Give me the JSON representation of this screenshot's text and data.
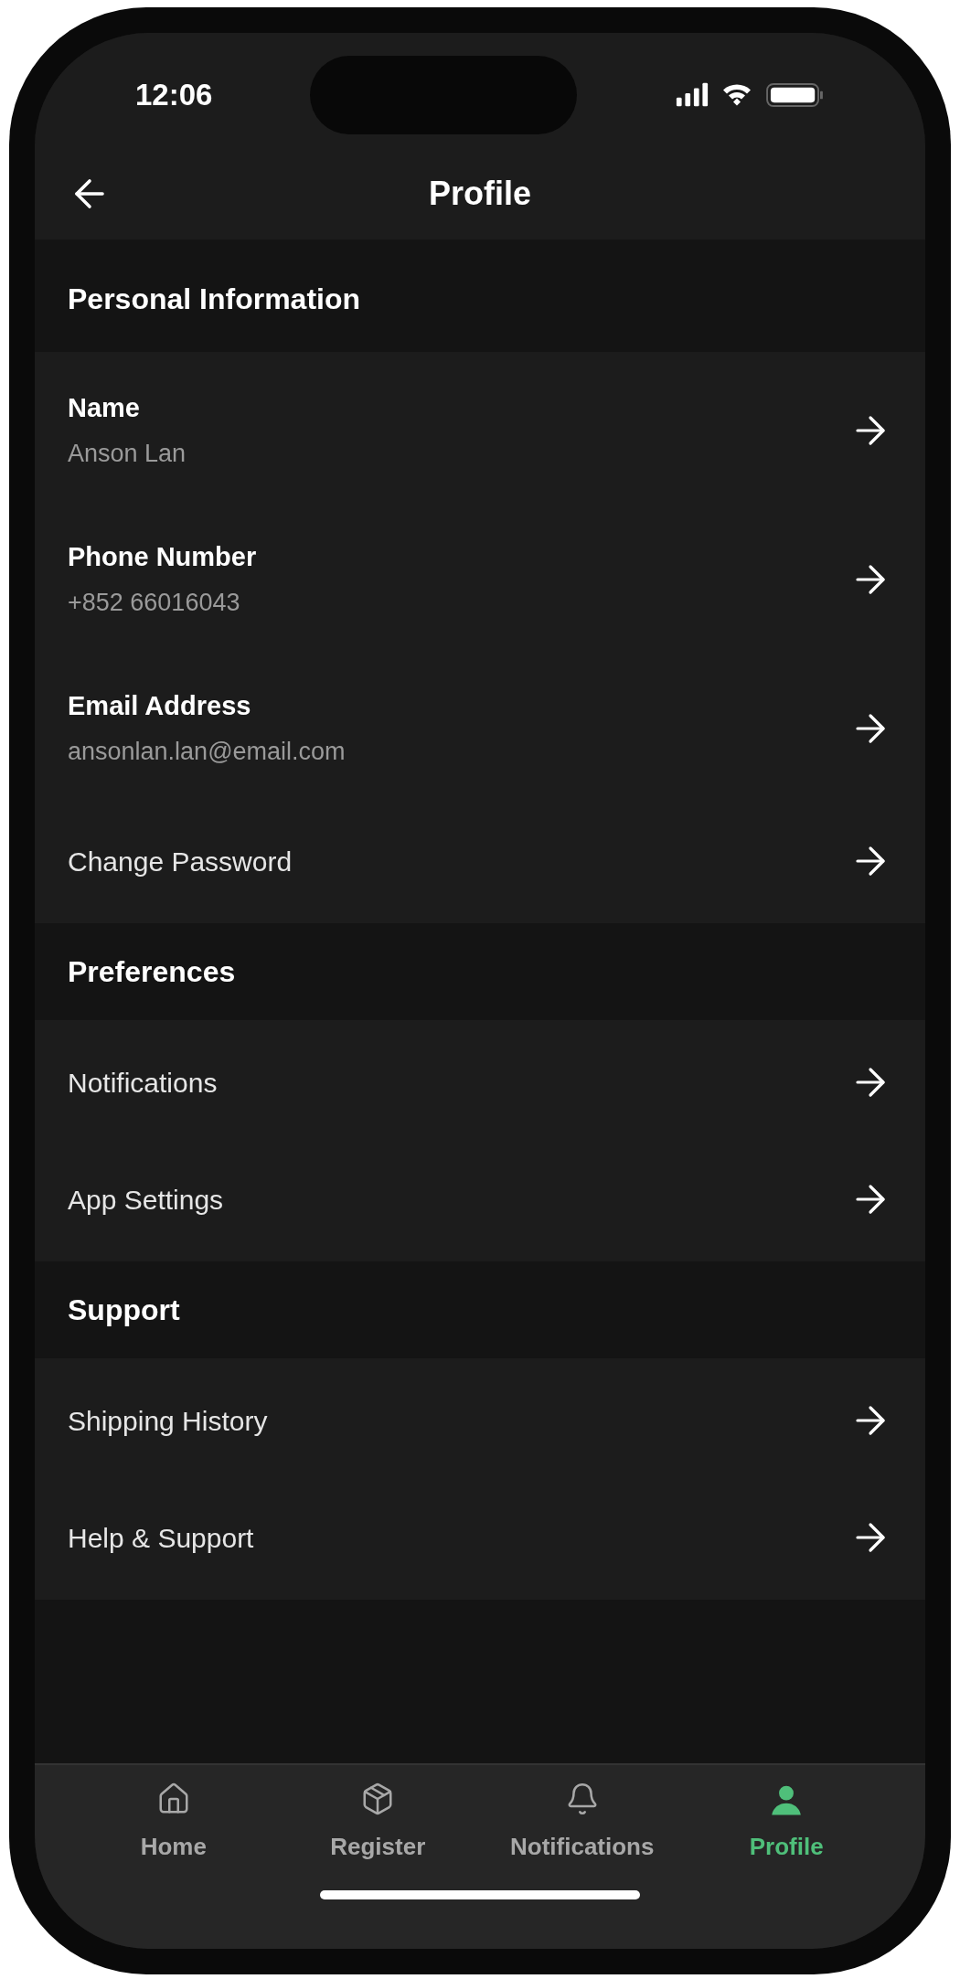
{
  "status_bar": {
    "time": "12:06"
  },
  "header": {
    "title": "Profile"
  },
  "sections": [
    {
      "title": "Personal Information",
      "items": [
        {
          "kind": "detail",
          "label": "Name",
          "value": "Anson Lan"
        },
        {
          "kind": "detail",
          "label": "Phone Number",
          "value": "+852 66016043"
        },
        {
          "kind": "detail",
          "label": "Email Address",
          "value": "ansonlan.lan@email.com"
        },
        {
          "kind": "link",
          "label": "Change Password"
        }
      ]
    },
    {
      "title": "Preferences",
      "items": [
        {
          "kind": "link",
          "label": "Notifications"
        },
        {
          "kind": "link",
          "label": "App Settings"
        }
      ]
    },
    {
      "title": "Support",
      "items": [
        {
          "kind": "link",
          "label": "Shipping History"
        },
        {
          "kind": "link",
          "label": "Help & Support"
        }
      ]
    }
  ],
  "tab_bar": [
    {
      "kind": "home",
      "label": "Home",
      "selected": false
    },
    {
      "kind": "box",
      "label": "Register",
      "selected": false
    },
    {
      "kind": "bell",
      "label": "Notifications",
      "selected": false
    },
    {
      "kind": "person",
      "label": "Profile",
      "selected": true
    }
  ]
}
